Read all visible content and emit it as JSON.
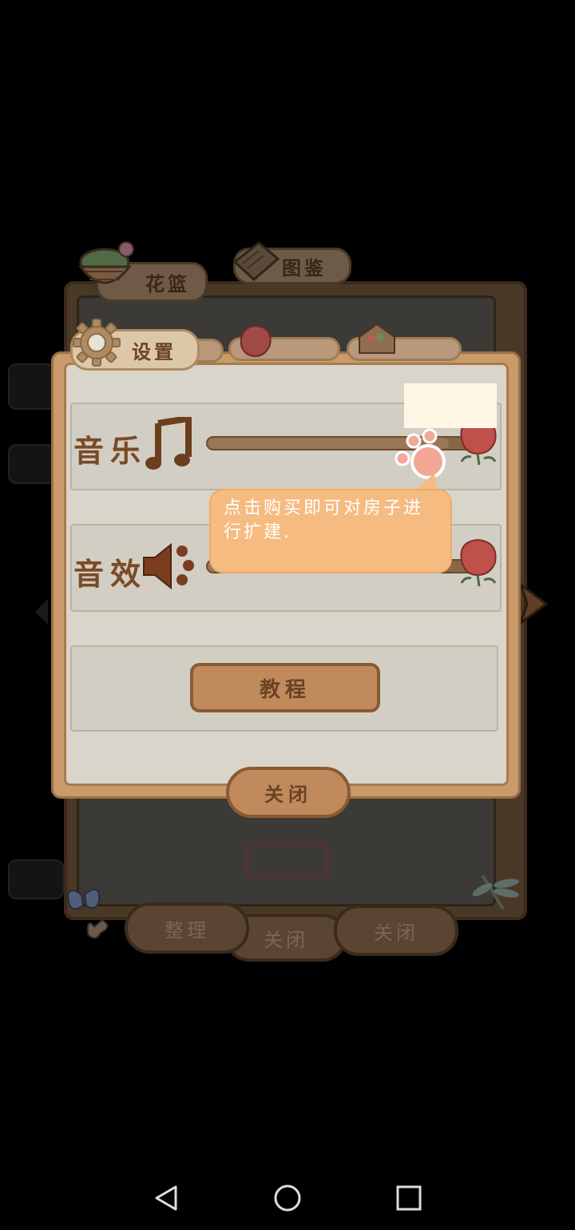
{
  "background_tabs": {
    "basket_label": "花篮",
    "catalog_label": "图鉴"
  },
  "back_buttons": {
    "sort_label": "整理",
    "close_left_label": "关闭",
    "close_right_label": "关闭"
  },
  "settings": {
    "tab_label": "设置",
    "music_label": "音乐",
    "sfx_label": "音效",
    "music_level": 0.9,
    "sfx_level": 0.9,
    "tutorial_label": "教程",
    "close_label": "关闭"
  },
  "tooltip": {
    "text": "点击购买即可对房子进行扩建."
  },
  "colors": {
    "panel": "#c99a6a",
    "paper": "#d2cec4",
    "accent_text": "#7a4a26",
    "tooltip": "#f5bb80"
  },
  "nav": {
    "back_icon": "triangle-back-icon",
    "home_icon": "circle-home-icon",
    "recents_icon": "square-recents-icon"
  }
}
